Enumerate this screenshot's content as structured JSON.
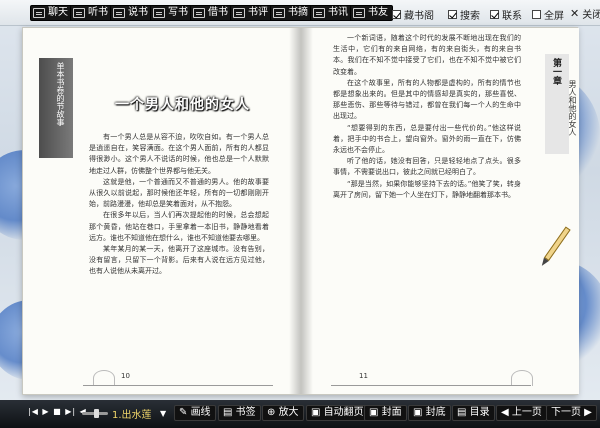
{
  "toolbar": {
    "buttons": [
      {
        "name": "chat-button",
        "label": "聊天"
      },
      {
        "name": "listen-button",
        "label": "听书"
      },
      {
        "name": "talk-button",
        "label": "说书"
      },
      {
        "name": "write-button",
        "label": "写书"
      },
      {
        "name": "lend-button",
        "label": "借书"
      },
      {
        "name": "review-button",
        "label": "书评"
      },
      {
        "name": "excerpt-button",
        "label": "书摘"
      },
      {
        "name": "bookinfo-button",
        "label": "书讯"
      },
      {
        "name": "bookfriend-button",
        "label": "书友"
      }
    ],
    "checkboxes": [
      {
        "name": "collect-checkbox",
        "label": "藏书阁",
        "checked": true
      },
      {
        "name": "search-checkbox",
        "label": "搜索",
        "checked": true
      },
      {
        "name": "contact-checkbox",
        "label": "联系",
        "checked": true
      },
      {
        "name": "fullscreen-checkbox",
        "label": "全屏",
        "checked": false
      }
    ],
    "close_label": "关闭"
  },
  "book": {
    "left_page": {
      "side_tab": "单本书卷的节故事",
      "chapter_title": "一个男人和他的女人",
      "paragraphs": [
        "有一个男人总是从容不迫，吹吹自如。有一个男人总是逍遥自在，笑容满面。在这个男人面前，所有的人都显得很渺小。这个男人不说话的时候，他也总是一个人默默地走过人群，仿佛整个世界都与他无关。",
        "这就是他，一个普通而又不普通的男人。他的故事要从很久以前说起，那时候他还年轻，所有的一切都刚刚开始，前路漫漫，他却总是笑着面对，从不抱怨。",
        "在很多年以后，当人们再次提起他的时候，总会想起那个黄昏，他站在巷口，手里拿着一本旧书，静静地看着远方。谁也不知道他在想什么，谁也不知道他要去哪里。",
        "某年某月的某一天，他离开了这座城市。没有告别，没有留言，只留下一个背影。后来有人说在远方见过他，也有人说他从未离开过。"
      ],
      "page_number": "10"
    },
    "right_page": {
      "side_tab": "第一章",
      "side_caption": "男人和他的女人",
      "paragraphs": [
        "一个新词语，随着这个时代的发展不断地出现在我们的生活中，它们有的来自网络，有的来自街头，有的来自书本。我们在不知不觉中接受了它们，也在不知不觉中被它们改变着。",
        "在这个故事里，所有的人物都是虚构的，所有的情节也都是想象出来的。但是其中的情感却是真实的，那些喜悦、那些悲伤、那些等待与错过，都曾在我们每一个人的生命中出现过。",
        "“想要得到的东西，总是要付出一些代价的。”他这样说着，把手中的书合上，望向窗外。窗外的雨一直在下，仿佛永远也不会停止。",
        "听了他的话，她没有回答，只是轻轻地点了点头。很多事情，不需要说出口，彼此之间就已经明白了。",
        "“那是当然，如果你能够坚持下去的话。”他笑了笑，转身离开了房间，留下她一个人坐在灯下，静静地翻着那本书。"
      ],
      "page_number": "11"
    }
  },
  "bottom_bar": {
    "track_title": "1.出水莲",
    "buttons": [
      {
        "name": "brush-button",
        "label": "画线"
      },
      {
        "name": "bookmark-button",
        "label": "书签"
      },
      {
        "name": "zoom-in-button",
        "label": "放大"
      },
      {
        "name": "auto-page-button",
        "label": "自动翻页"
      },
      {
        "name": "cover-button",
        "label": "封面"
      },
      {
        "name": "back-cover-button",
        "label": "封底"
      },
      {
        "name": "toc-button",
        "label": "目录"
      },
      {
        "name": "prev-page-button",
        "label": "上一页"
      },
      {
        "name": "next-page-button",
        "label": "下一页"
      }
    ]
  }
}
